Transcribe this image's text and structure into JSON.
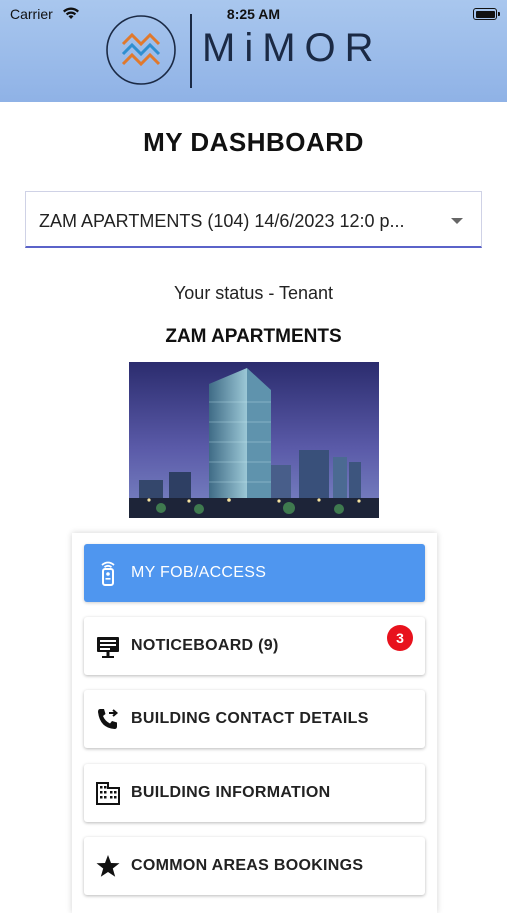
{
  "status_bar": {
    "carrier": "Carrier",
    "time": "8:25 AM"
  },
  "brand": {
    "name": "MiMOR"
  },
  "page": {
    "title": "MY DASHBOARD"
  },
  "property_select": {
    "selected": "ZAM APARTMENTS (104) 14/6/2023 12:0 p..."
  },
  "status": {
    "text": "Your status - Tenant"
  },
  "building": {
    "name": "ZAM APARTMENTS"
  },
  "menu": {
    "items": [
      {
        "label": "MY FOB/ACCESS",
        "icon": "fob-remote-icon",
        "active": true
      },
      {
        "label": "NOTICEBOARD (9)",
        "icon": "noticeboard-icon",
        "badge": "3"
      },
      {
        "label": "BUILDING CONTACT DETAILS",
        "icon": "phone-forward-icon"
      },
      {
        "label": "BUILDING INFORMATION",
        "icon": "building-icon"
      },
      {
        "label": "COMMON AREAS BOOKINGS",
        "icon": "star-icon"
      }
    ]
  },
  "colors": {
    "header": "#a9c7ee",
    "accent": "#4f96ef",
    "badge": "#e8121d",
    "brand_text": "#1b2a45"
  }
}
